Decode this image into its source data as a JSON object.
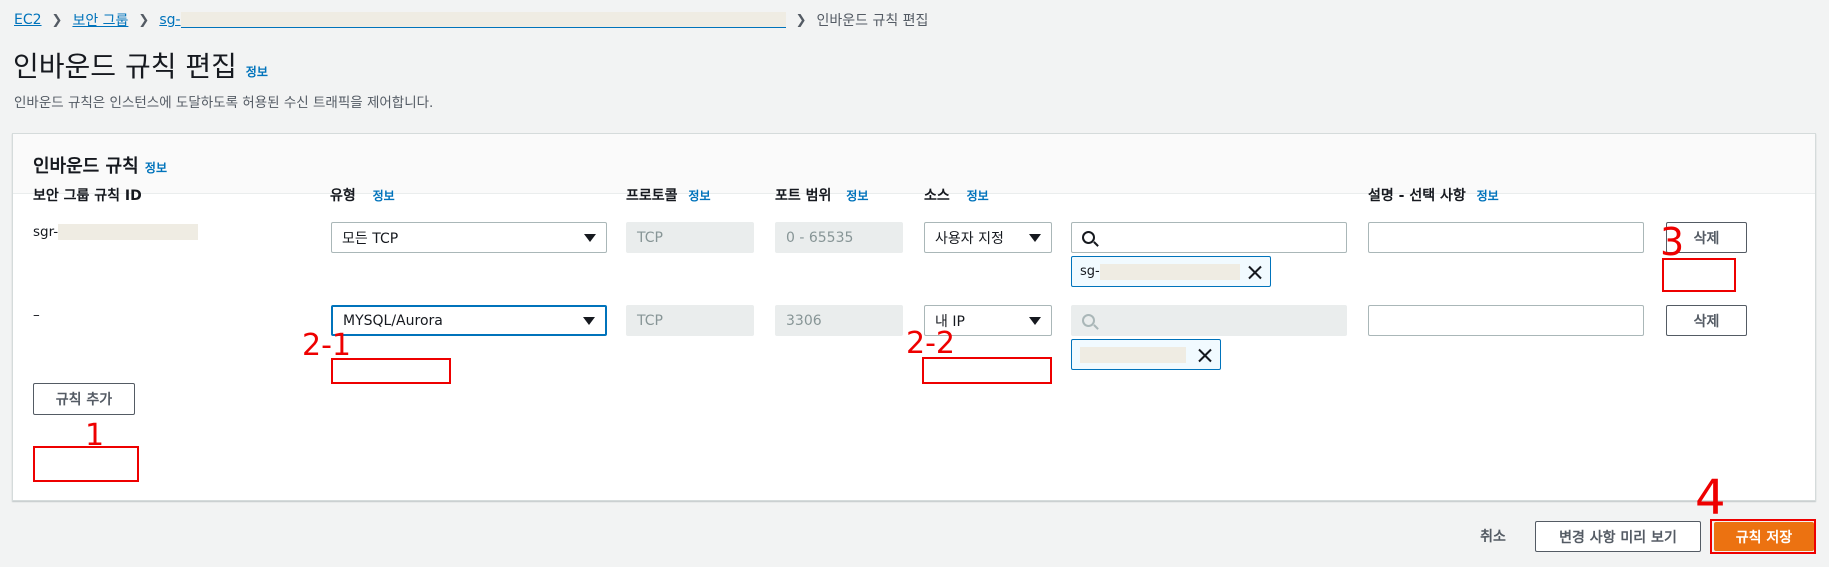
{
  "breadcrumb": {
    "items": [
      "EC2",
      "보안 그룹",
      "sg-",
      "인바운드 규칙 편집"
    ]
  },
  "page": {
    "title": "인바운드 규칙 편집",
    "info": "정보",
    "description": "인바운드 규칙은 인스턴스에 도달하도록 허용된 수신 트래픽을 제어합니다."
  },
  "panel": {
    "title": "인바운드 규칙",
    "info": "정보"
  },
  "columns": {
    "rule_id": "보안 그룹 규칙 ID",
    "type": "유형",
    "protocol": "프로토콜",
    "port_range": "포트 범위",
    "source": "소스",
    "description": "설명 - 선택 사항",
    "info": "정보"
  },
  "rows": [
    {
      "rule_id": "sgr-",
      "type": "모든 TCP",
      "protocol": "TCP",
      "port_range": "0 - 65535",
      "source_type": "사용자 지정",
      "source_search": "",
      "source_token": "sg-",
      "description": "",
      "delete_label": "삭제"
    },
    {
      "rule_id": "–",
      "type": "MYSQL/Aurora",
      "protocol": "TCP",
      "port_range": "3306",
      "source_type": "내 IP",
      "source_search": "",
      "source_token": "",
      "description": "",
      "delete_label": "삭제"
    }
  ],
  "actions": {
    "add_rule": "규칙 추가",
    "cancel": "취소",
    "preview": "변경 사항 미리 보기",
    "save": "규칙 저장"
  },
  "annotations": {
    "add_rule": "1",
    "type": "2-1",
    "source_type": "2-2",
    "delete": "3",
    "save": "4"
  }
}
